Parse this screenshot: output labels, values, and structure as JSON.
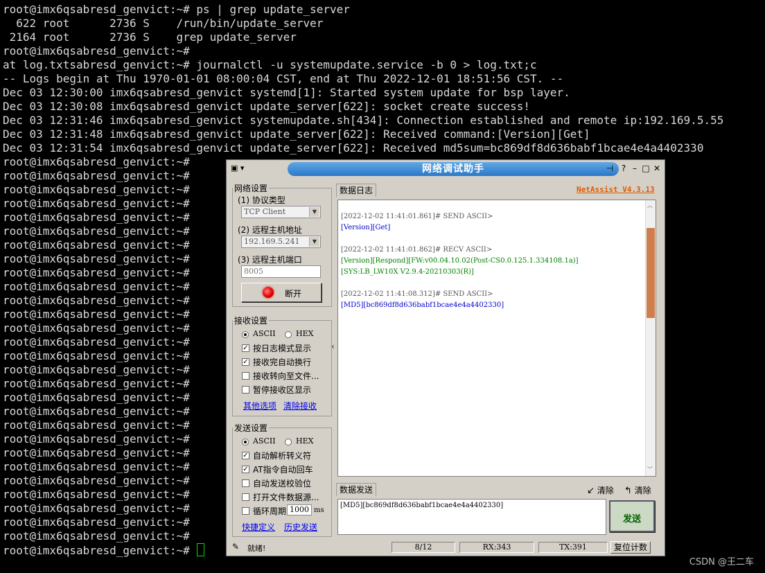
{
  "terminal": {
    "lines": [
      "root@imx6qsabresd_genvict:~# ps | grep update_server",
      "  622 root      2736 S    /run/bin/update_server",
      " 2164 root      2736 S    grep update_server",
      "root@imx6qsabresd_genvict:~#",
      "at log.txtsabresd_genvict:~# journalctl -u systemupdate.service -b 0 > log.txt;c",
      "-- Logs begin at Thu 1970-01-01 08:00:04 CST, end at Thu 2022-12-01 18:51:56 CST. --",
      "Dec 03 12:30:00 imx6qsabresd_genvict systemd[1]: Started system update for bsp layer.",
      "Dec 03 12:30:08 imx6qsabresd_genvict update_server[622]: socket create success!",
      "Dec 03 12:31:46 imx6qsabresd_genvict systemupdate.sh[434]: Connection established and remote ip:192.169.5.55",
      "Dec 03 12:31:48 imx6qsabresd_genvict update_server[622]: Received command:[Version][Get]",
      "Dec 03 12:31:54 imx6qsabresd_genvict update_server[622]: Received md5sum=bc869df8d636babf1bcae4e4a4402330"
    ],
    "prompt": "root@imx6qsabresd_genvict:~#",
    "prompt_count": 29,
    "watermark": "CSDN @王二车"
  },
  "app": {
    "title": "网络调试助手",
    "sysmenu": "▣ ▾",
    "brand": "NetAssist V4.3.13",
    "brand_color": "#e05a00",
    "network": {
      "legend": "网络设置",
      "protocol_label": "(1) 协议类型",
      "protocol_value": "TCP Client",
      "host_label": "(2) 远程主机地址",
      "host_value": "192.169.5.241",
      "port_label": "(3) 远程主机端口",
      "port_value": "8005",
      "disconnect_label": "断开"
    },
    "receive": {
      "legend": "接收设置",
      "ascii": "ASCII",
      "hex": "HEX",
      "opt1": "按日志模式显示",
      "opt2": "接收完自动换行",
      "opt3": "接收转向至文件...",
      "opt4": "暂停接收区显示",
      "link1": "其他选项",
      "link2": "清除接收"
    },
    "send_settings": {
      "legend": "发送设置",
      "ascii": "ASCII",
      "hex": "HEX",
      "opt1": "自动解析转义符",
      "opt2": "AT指令自动回车",
      "opt3": "自动发送校验位",
      "opt4": "打开文件数据源...",
      "opt5": "循环周期",
      "period": "1000",
      "unit": "ms",
      "link1": "快捷定义",
      "link2": "历史发送"
    },
    "log_tab": "数据日志",
    "log": [
      {
        "text": "[2022-12-02 11:41:01.861]# SEND ASCII>",
        "color": "#555555"
      },
      {
        "text": "[Version][Get]",
        "color": "#0000cc"
      },
      {
        "text": "",
        "color": "#000000"
      },
      {
        "text": "[2022-12-02 11:41:01.862]# RECV ASCII>",
        "color": "#555555"
      },
      {
        "text": "[Version][Respond][FW:v00.04.10.02(Post-CS0.0.125.1.334108.1a)]",
        "color": "#008000"
      },
      {
        "text": "[SYS:LB_LW10X V2.9.4-20210303(R)]",
        "color": "#008000"
      },
      {
        "text": "",
        "color": "#000000"
      },
      {
        "text": "[2022-12-02 11:41:08.312]# SEND ASCII>",
        "color": "#555555"
      },
      {
        "text": "[MD5][bc869df8d636babf1bcae4e4a4402330]",
        "color": "#0000cc"
      }
    ],
    "send_tab": "数据发送",
    "clear1": "清除",
    "clear2": "清除",
    "send_text": "[MD5][bc869df8d636babf1bcae4e4a4402330]",
    "send_button": "发送",
    "status": {
      "ready": "就绪!",
      "count": "8/12",
      "rx": "RX:343",
      "tx": "TX:391",
      "reset": "复位计数"
    }
  }
}
